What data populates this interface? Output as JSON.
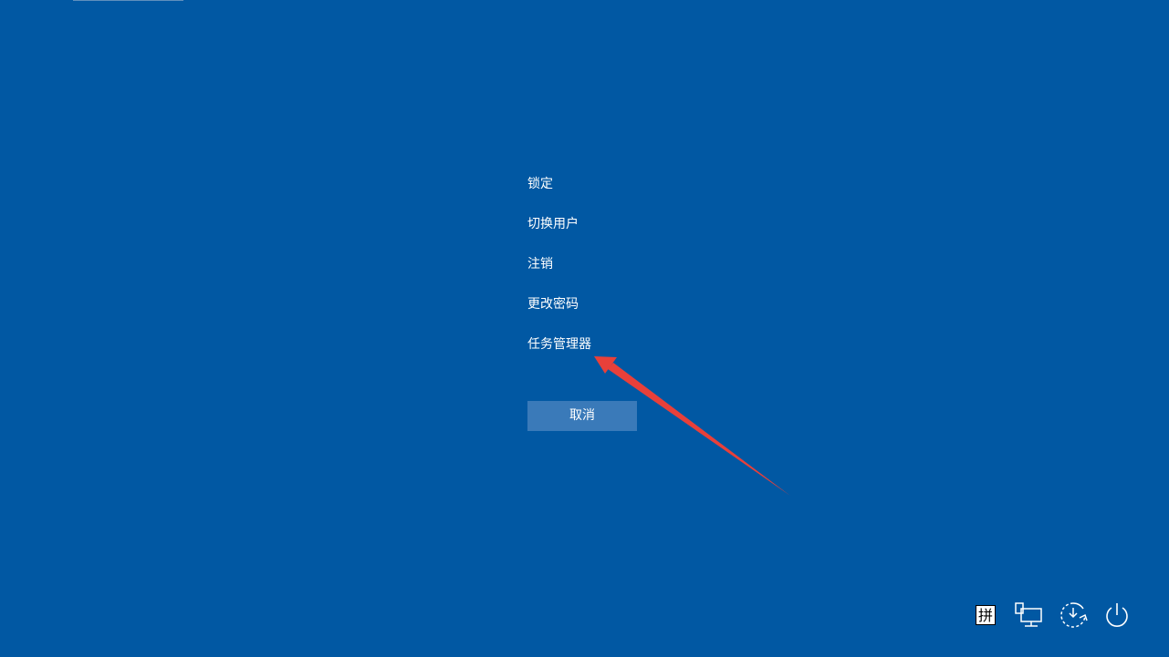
{
  "menu": {
    "items": [
      {
        "label": "锁定"
      },
      {
        "label": "切换用户"
      },
      {
        "label": "注销"
      },
      {
        "label": "更改密码"
      },
      {
        "label": "任务管理器"
      }
    ]
  },
  "cancel_button": {
    "label": "取消"
  },
  "tray": {
    "ime_label": "拼",
    "icons": [
      "ime-icon",
      "network-icon",
      "accessibility-icon",
      "power-icon"
    ]
  },
  "colors": {
    "background": "#0158a3",
    "button": "#3a7ab9",
    "annotation_arrow": "#e8403a"
  }
}
